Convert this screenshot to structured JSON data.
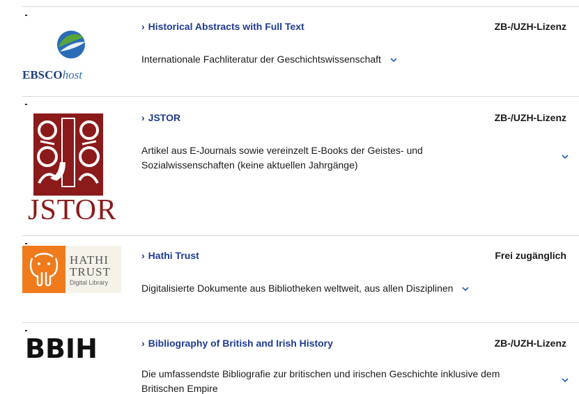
{
  "entries": [
    {
      "title": "Historical Abstracts with Full Text",
      "license": "ZB-/UZH-Lizenz",
      "description": "Internationale Fachliteratur der Geschichtswissenschaft",
      "logo": {
        "wordmark_bold": "EBSCO",
        "wordmark_italic": "host",
        "icon": "ebsco-globe-icon"
      }
    },
    {
      "title": "JSTOR",
      "license": "ZB-/UZH-Lizenz",
      "description_line1": "Artikel aus E-Journals sowie vereinzelt E-Books der Geistes- und",
      "description_line2": "Sozialwissenschaften (keine aktuellen Jahrgänge)",
      "logo": {
        "wordmark": "JSTOR",
        "icon": "jstor-ornament-icon"
      }
    },
    {
      "title": "Hathi Trust",
      "license": "Frei zugänglich",
      "description": "Digitalisierte Dokumente aus Bibliotheken weltweit, aus allen Disziplinen",
      "logo": {
        "line1": "HATHI",
        "line2": "TRUST",
        "line3": "Digital Library",
        "icon": "elephant-icon"
      }
    },
    {
      "title": "Bibliography of British and Irish History",
      "license": "ZB-/UZH-Lizenz",
      "description_line1": "Die umfassendste Bibliografie zur britischen und irischen Geschichte inklusive dem",
      "description_line2": "Britischen Empire",
      "logo": {
        "wordmark": "BBIH"
      }
    }
  ],
  "colors": {
    "link": "#1f3a93",
    "expand": "#1f5fc4",
    "jstor": "#8b1a1a",
    "hathi_orange": "#f07b1d",
    "divider": "#d9d9d9"
  },
  "icons": {
    "title_chevron": "chevron-right-icon",
    "expand": "chevron-down-icon"
  }
}
